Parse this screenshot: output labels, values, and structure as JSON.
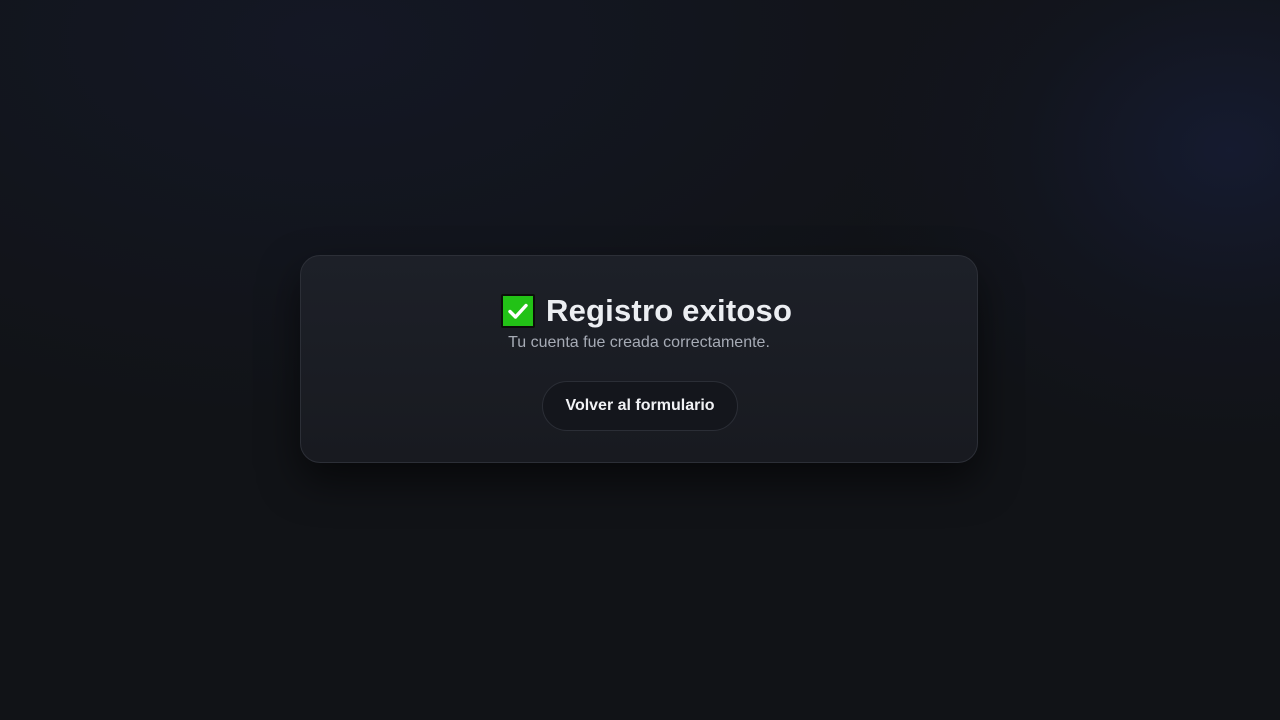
{
  "success_card": {
    "icon": "check-box-icon",
    "icon_color": "#22c216",
    "title": "Registro exitoso",
    "message": "Tu cuenta fue creada correctamente.",
    "back_button_label": "Volver al formulario"
  }
}
